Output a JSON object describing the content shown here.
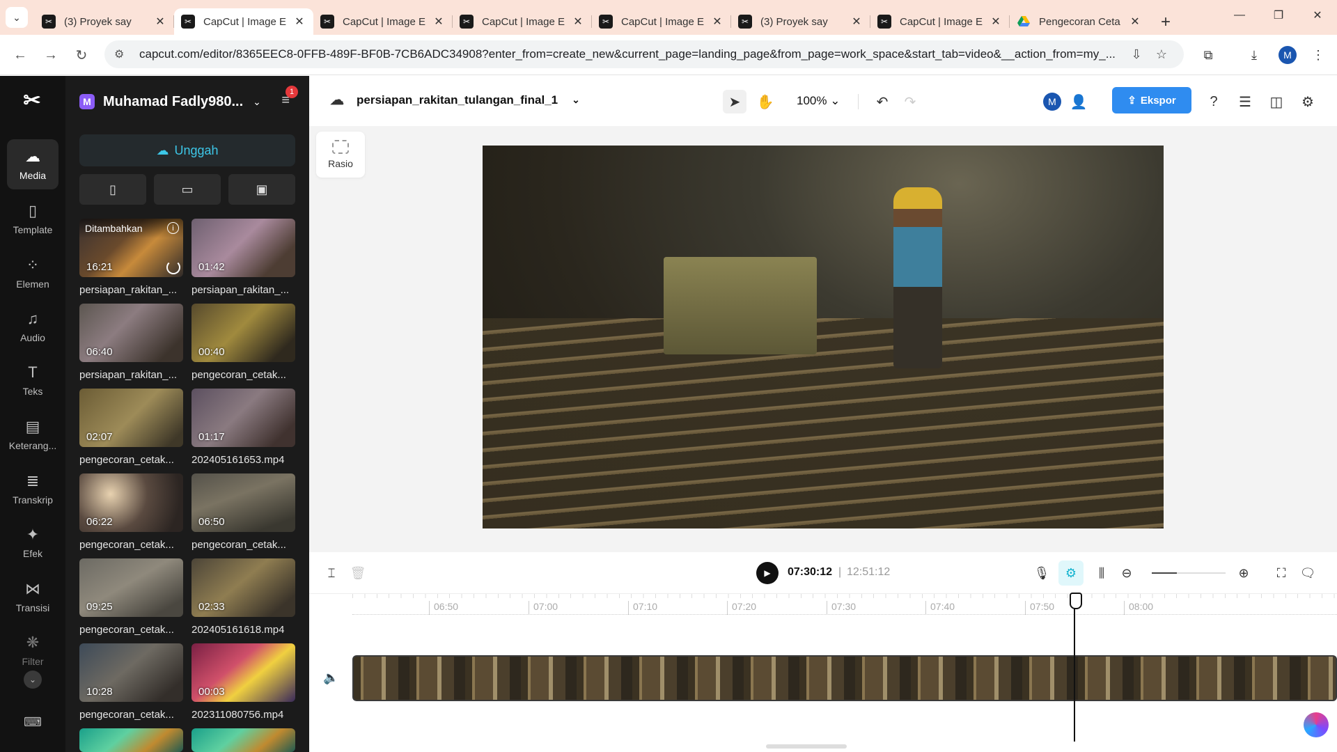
{
  "browser": {
    "tabs": [
      {
        "title": "(3) Proyek say",
        "favicon": "capcut-icon",
        "active": false
      },
      {
        "title": "CapCut | Image E",
        "favicon": "capcut-icon",
        "active": true
      },
      {
        "title": "CapCut | Image E",
        "favicon": "capcut-icon",
        "active": false
      },
      {
        "title": "CapCut | Image E",
        "favicon": "capcut-icon",
        "active": false
      },
      {
        "title": "CapCut | Image E",
        "favicon": "capcut-icon",
        "active": false
      },
      {
        "title": "(3) Proyek say",
        "favicon": "capcut-icon",
        "active": false
      },
      {
        "title": "CapCut | Image E",
        "favicon": "capcut-icon",
        "active": false
      },
      {
        "title": "Pengecoran Ceta",
        "favicon": "google-drive-icon",
        "active": false
      }
    ],
    "url": "capcut.com/editor/8365EEC8-0FFB-489F-BF0B-7CB6ADC34908?enter_from=create_new&current_page=landing_page&from_page=work_space&start_tab=video&__action_from=my_...",
    "profile_initial": "M"
  },
  "rail": {
    "items": [
      {
        "label": "Media",
        "icon": "cloud-icon",
        "active": true
      },
      {
        "label": "Template",
        "icon": "template-icon",
        "active": false
      },
      {
        "label": "Elemen",
        "icon": "elements-icon",
        "active": false
      },
      {
        "label": "Audio",
        "icon": "music-note-icon",
        "active": false
      },
      {
        "label": "Teks",
        "icon": "text-icon",
        "active": false
      },
      {
        "label": "Keterang...",
        "icon": "captions-icon",
        "active": false
      },
      {
        "label": "Transkrip",
        "icon": "transcript-icon",
        "active": false
      },
      {
        "label": "Efek",
        "icon": "effects-icon",
        "active": false
      },
      {
        "label": "Transisi",
        "icon": "transition-icon",
        "active": false
      },
      {
        "label": "Filter",
        "icon": "filter-icon",
        "active": false
      }
    ]
  },
  "panel": {
    "account_initial": "M",
    "account_name": "Muhamad Fadly980...",
    "notification_count": "1",
    "upload_label": "Unggah",
    "media": [
      {
        "duration": "16:21",
        "caption": "persiapan_rakitan_...",
        "tag": "Ditambahkan"
      },
      {
        "duration": "01:42",
        "caption": "persiapan_rakitan_..."
      },
      {
        "duration": "06:40",
        "caption": "persiapan_rakitan_..."
      },
      {
        "duration": "00:40",
        "caption": "pengecoran_cetak..."
      },
      {
        "duration": "02:07",
        "caption": "pengecoran_cetak..."
      },
      {
        "duration": "01:17",
        "caption": "202405161653.mp4"
      },
      {
        "duration": "06:22",
        "caption": "pengecoran_cetak..."
      },
      {
        "duration": "06:50",
        "caption": "pengecoran_cetak..."
      },
      {
        "duration": "09:25",
        "caption": "pengecoran_cetak..."
      },
      {
        "duration": "02:33",
        "caption": "202405161618.mp4"
      },
      {
        "duration": "10:28",
        "caption": "pengecoran_cetak..."
      },
      {
        "duration": "00:03",
        "caption": "202311080756.mp4"
      }
    ]
  },
  "editor": {
    "project_name": "persiapan_rakitan_tulangan_final_1",
    "zoom": "100%",
    "collaborator_initial": "M",
    "export_label": "Ekspor",
    "rasio_label": "Rasio"
  },
  "timeline": {
    "current_time": "07:30:12",
    "separator": "|",
    "total_time": "12:51:12",
    "ticks": [
      "06:50",
      "07:00",
      "07:10",
      "07:20",
      "07:30",
      "07:40",
      "07:50",
      "08:00"
    ]
  }
}
